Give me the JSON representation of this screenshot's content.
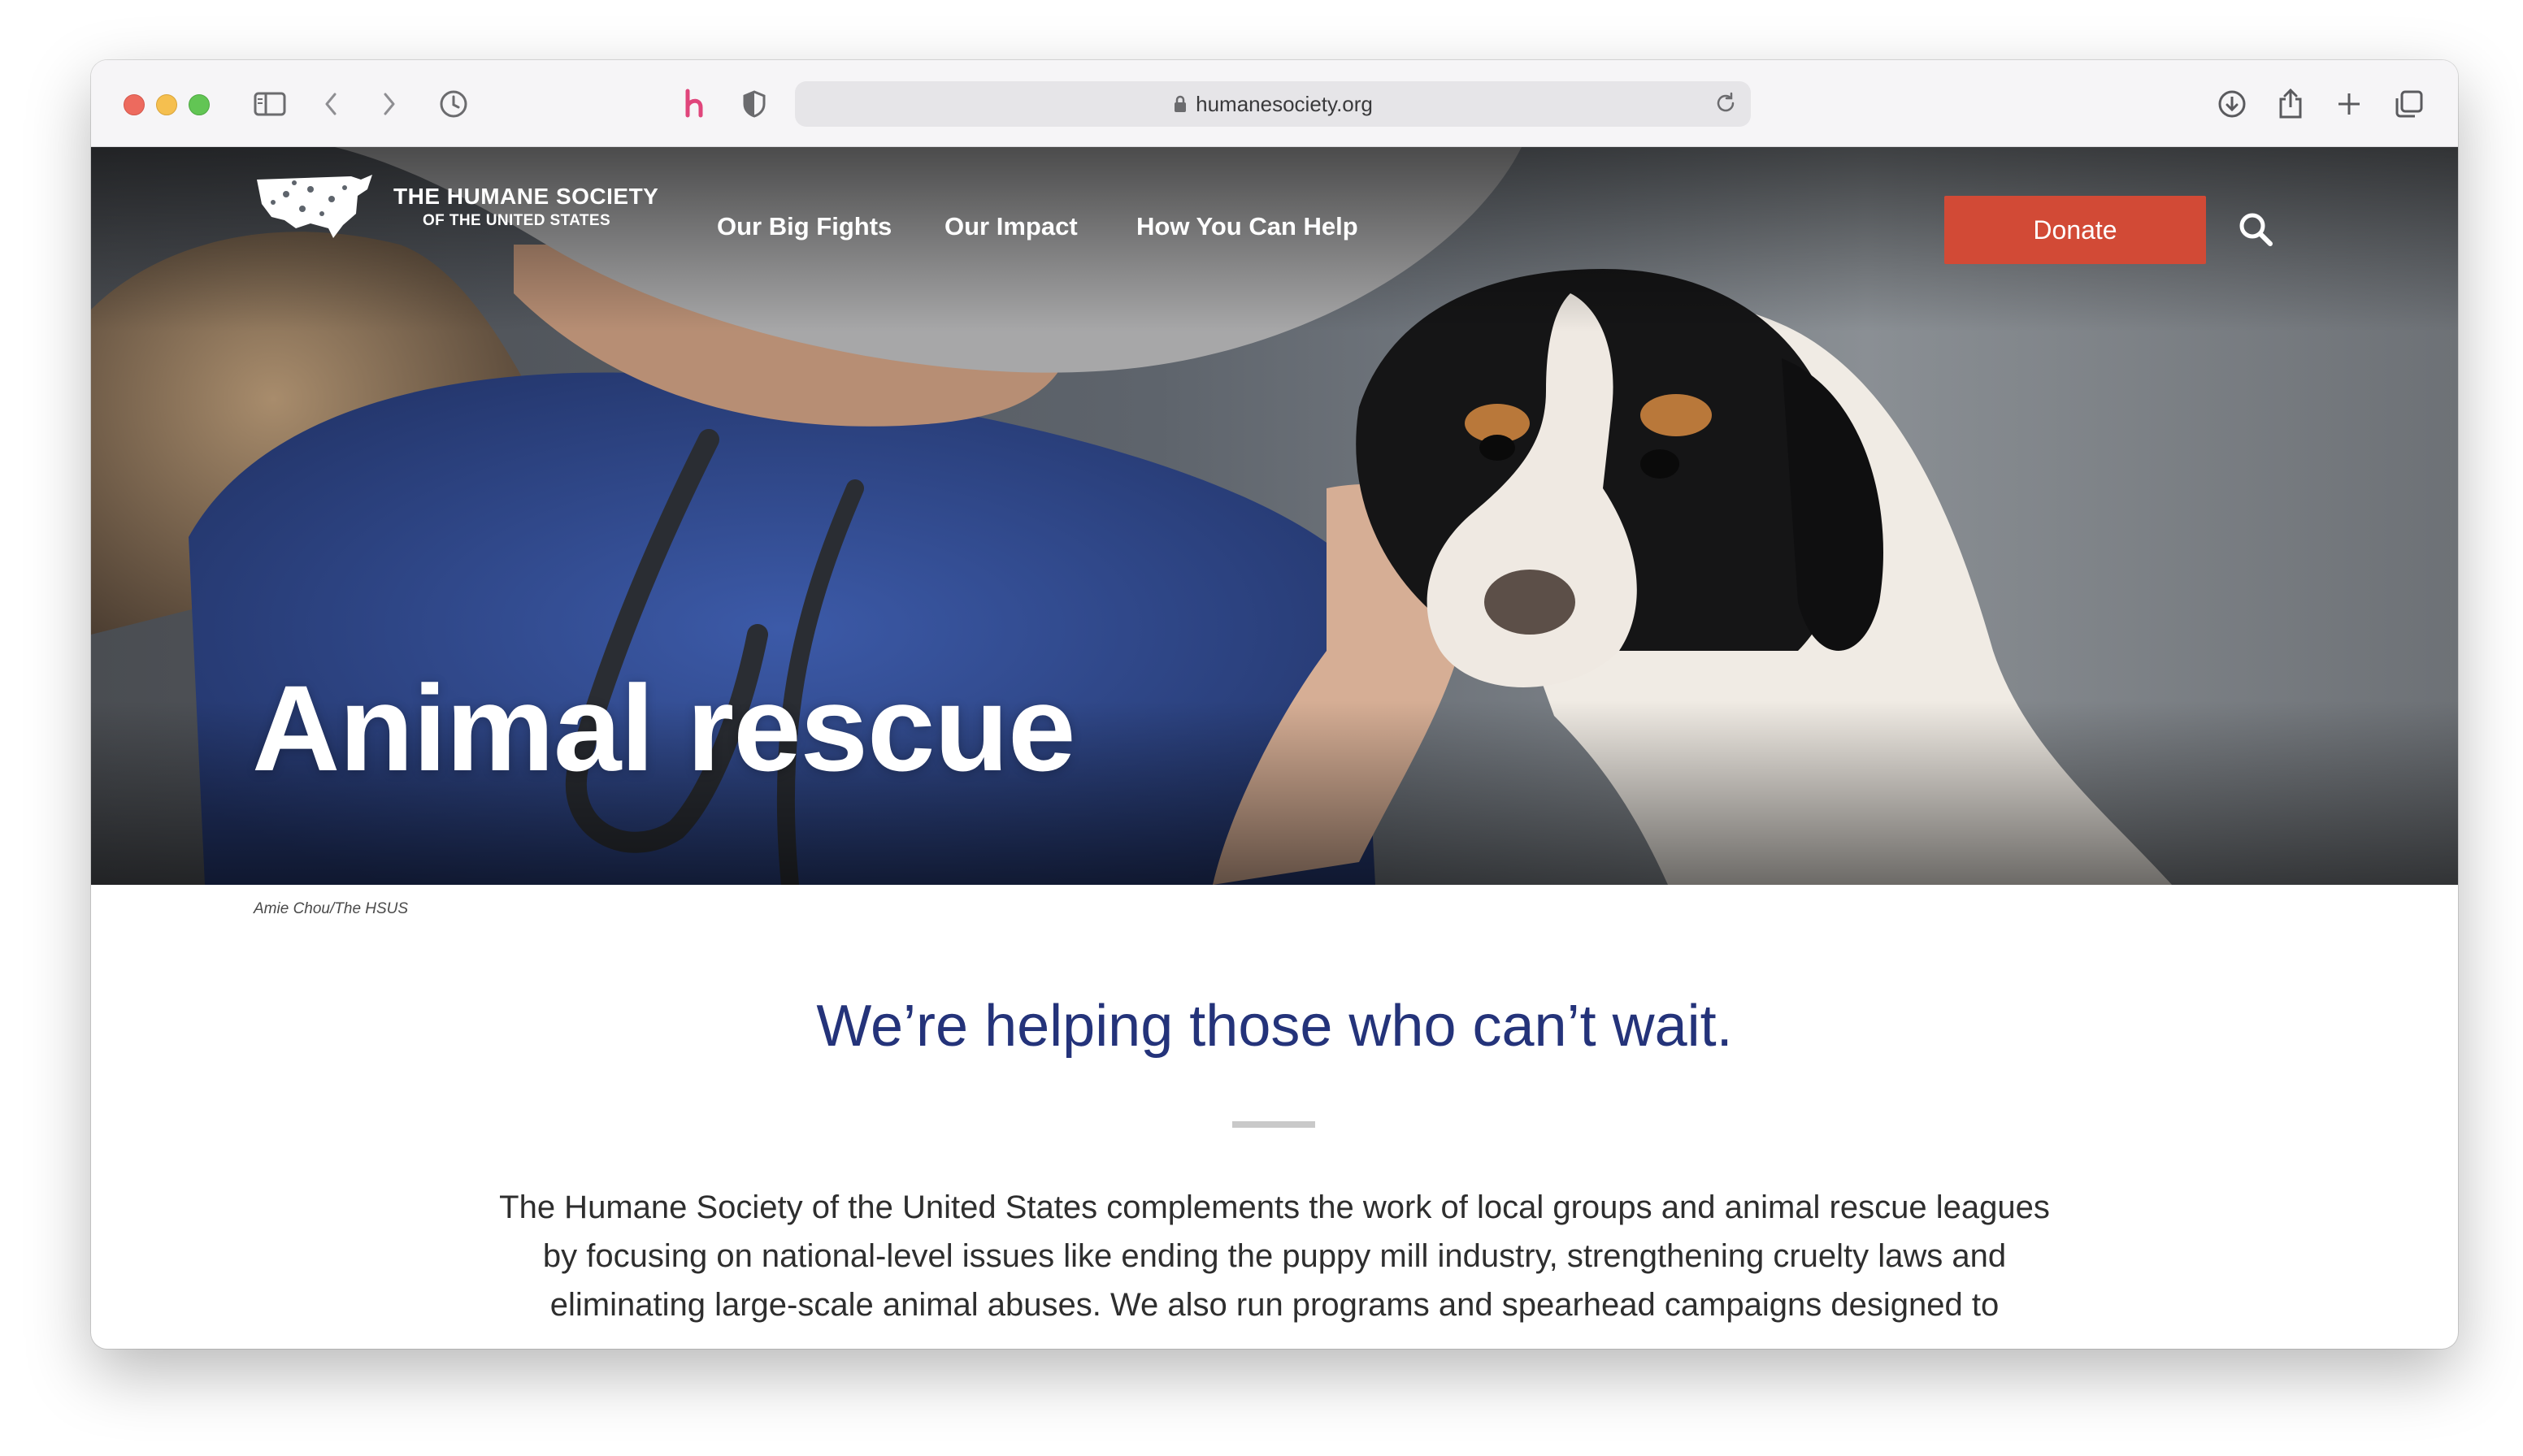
{
  "browser": {
    "url": "humanesociety.org",
    "icons": [
      "sidebar-icon",
      "back-icon",
      "forward-icon",
      "history-icon",
      "honey-extension-icon",
      "privacy-shield-icon",
      "lock-icon",
      "reload-icon",
      "download-icon",
      "share-icon",
      "new-tab-icon",
      "tabs-overview-icon"
    ]
  },
  "site": {
    "logo": {
      "line1": "THE HUMANE SOCIETY",
      "line2": "OF THE UNITED STATES"
    },
    "nav": [
      "Our Big Fights",
      "Our Impact",
      "How You Can Help"
    ],
    "donate_label": "Donate",
    "hero_title": "Animal rescue",
    "photo_credit": "Amie Chou/The HSUS",
    "headline": "We’re helping those who can’t wait.",
    "body": "The Humane Society of the United States complements the work of local groups and animal rescue leagues by focusing on national-level issues like ending the puppy mill industry, strengthening cruelty laws and eliminating large-scale animal abuses. We also run programs and spearhead campaigns designed to"
  },
  "colors": {
    "donate": "#d24a36",
    "headline": "#24337a",
    "toolbar": "#f6f5f7"
  }
}
